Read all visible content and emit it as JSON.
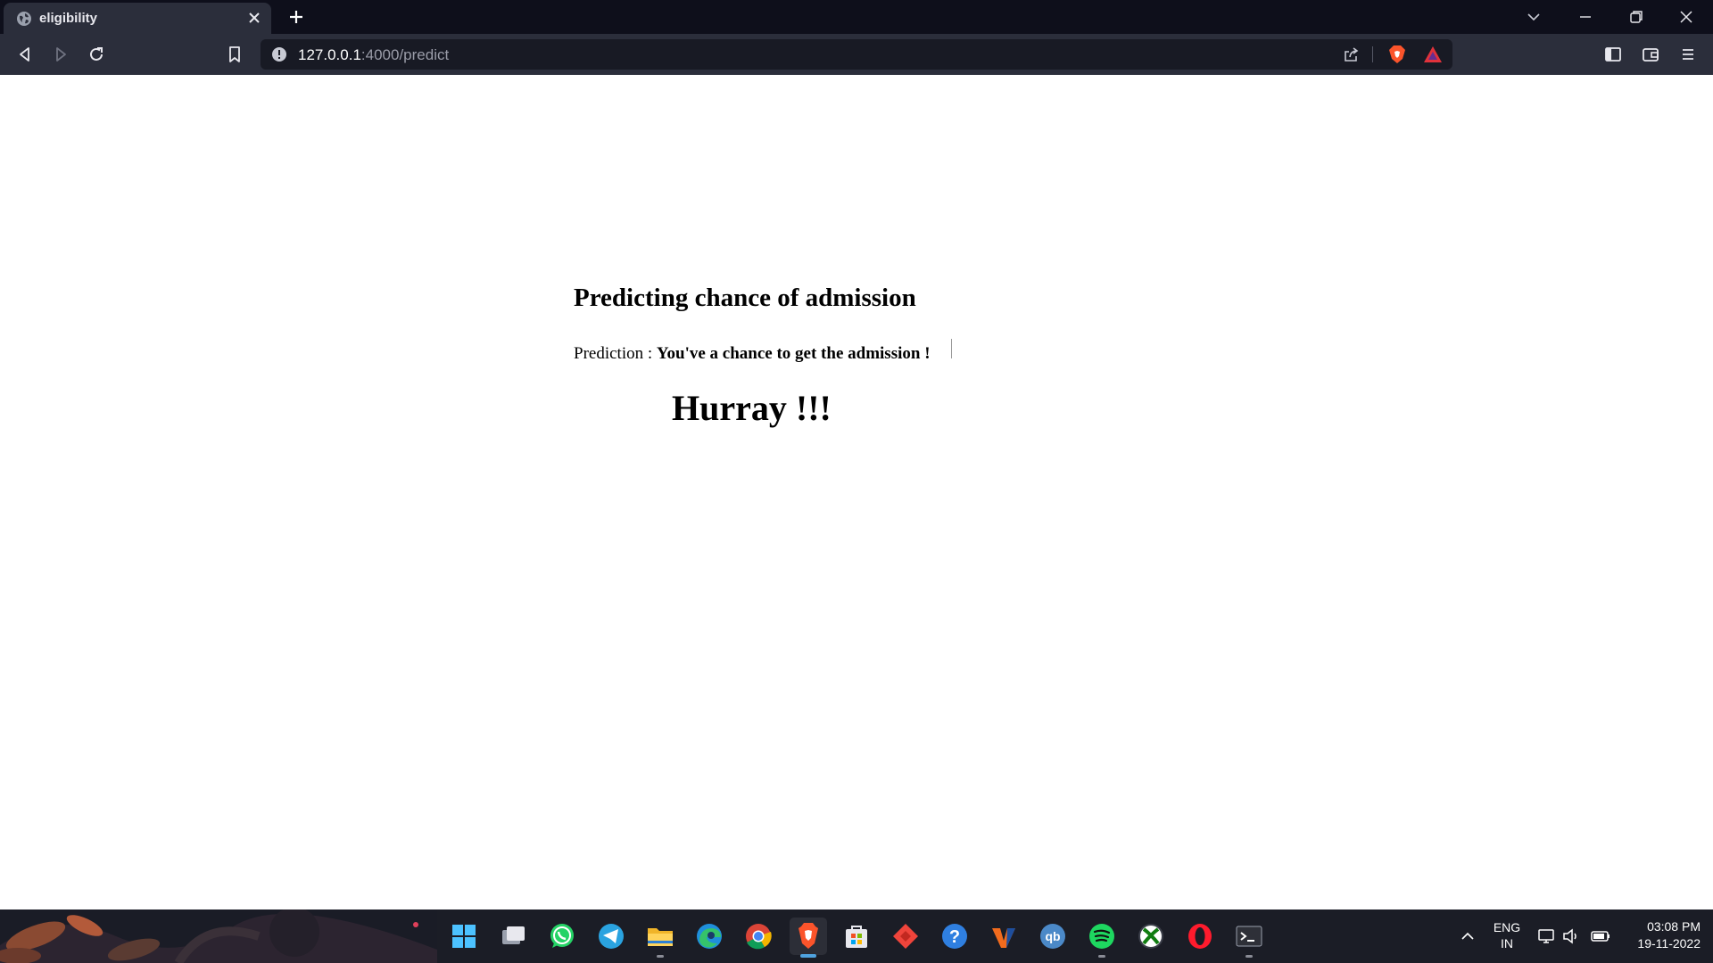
{
  "browser": {
    "tab": {
      "title": "eligibility",
      "favicon": "globe-icon"
    },
    "address_bar": {
      "host": "127.0.0.1",
      "path": ":4000/predict"
    },
    "icons": [
      "back-icon",
      "forward-icon",
      "reload-icon",
      "bookmark-icon",
      "info-icon",
      "share-icon",
      "brave-shields-icon",
      "brave-rewards-icon",
      "sidebar-icon",
      "wallet-icon",
      "menu-icon"
    ]
  },
  "page": {
    "heading": "Predicting chance of admission",
    "prediction_label": "Prediction : ",
    "prediction_value": "You've a chance to get the admission !",
    "celebration": "Hurray !!!"
  },
  "taskbar": {
    "apps": [
      "start",
      "task-view",
      "whatsapp",
      "telegram",
      "file-explorer",
      "edge",
      "chrome",
      "brave",
      "microsoft-store",
      "anydesk",
      "help",
      "vlc-style-app",
      "qbittorrent",
      "spotify",
      "xbox",
      "opera",
      "terminal"
    ],
    "tray": {
      "lang_line1": "ENG",
      "lang_line2": "IN",
      "time": "03:08 PM",
      "date": "19-11-2022"
    }
  },
  "colors": {
    "tabstrip": "#0e0f1b",
    "toolbar": "#2b2e3b",
    "omnibox": "#181a24",
    "page_bg": "#ffffff",
    "brave_orange": "#fb542b"
  }
}
